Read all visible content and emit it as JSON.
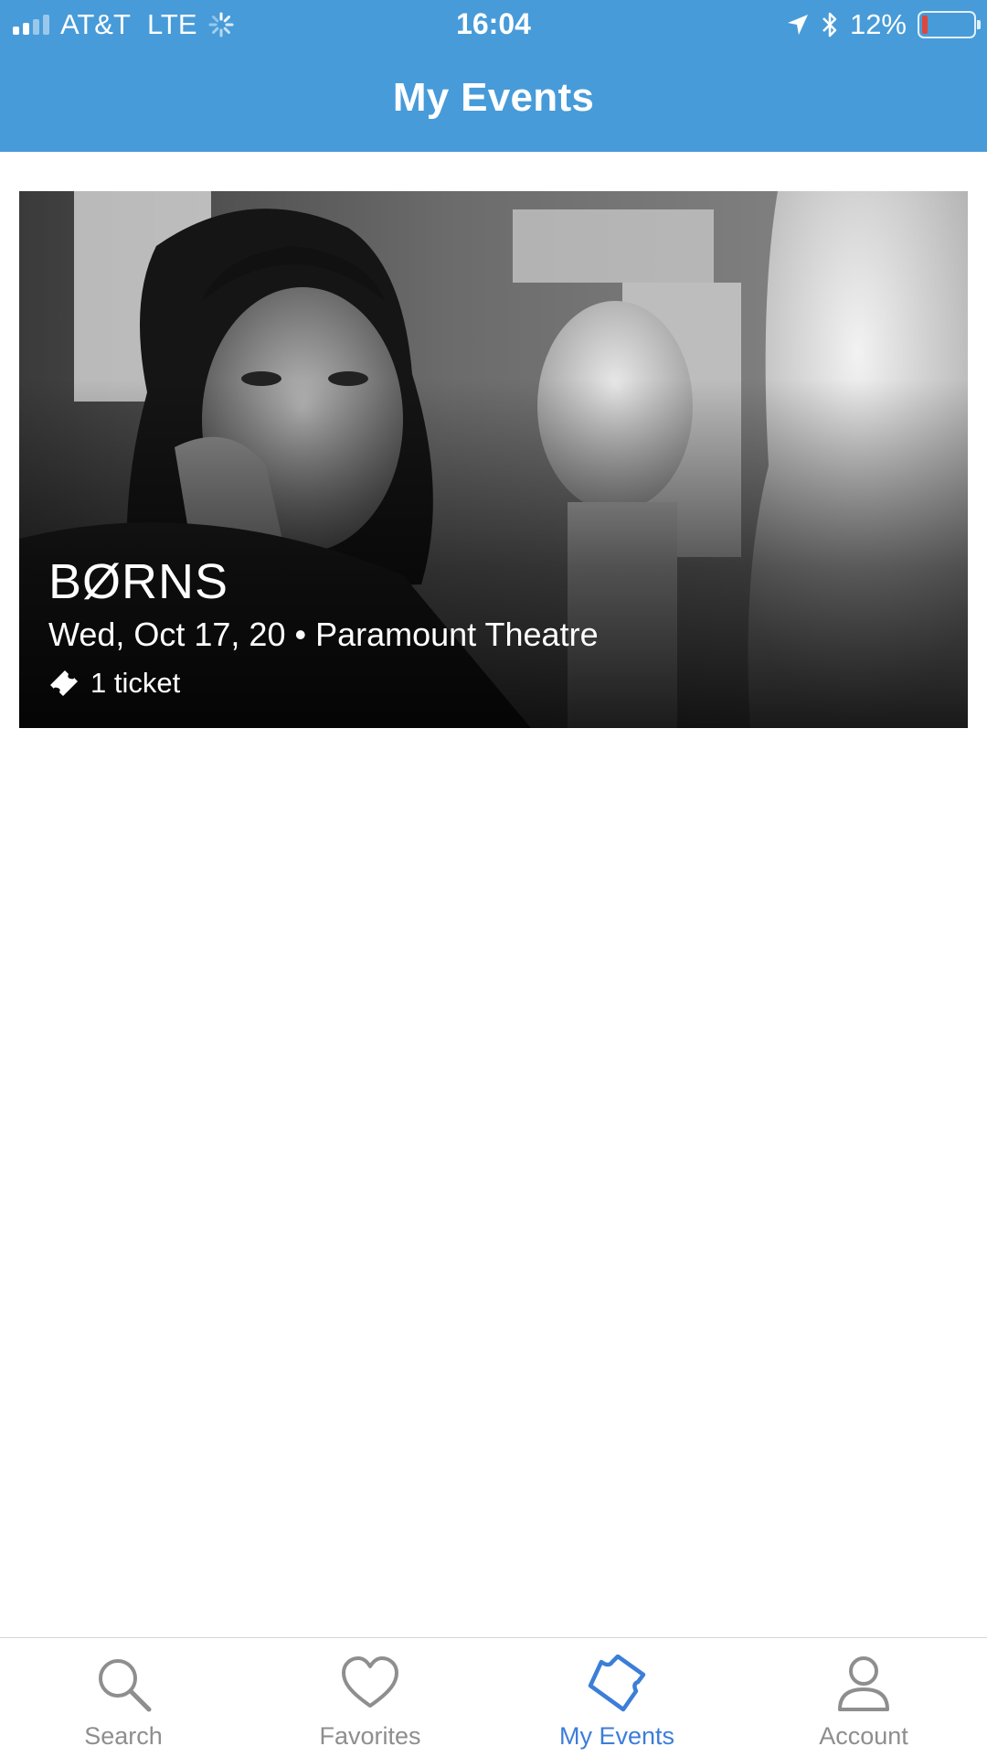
{
  "status_bar": {
    "carrier": "AT&T",
    "network": "LTE",
    "time": "16:04",
    "battery_percent": "12%",
    "battery_level": 0.12
  },
  "header": {
    "title": "My Events"
  },
  "events": [
    {
      "name": "BØRNS",
      "details": "Wed, Oct 17, 20 • Paramount Theatre",
      "tickets": "1 ticket"
    }
  ],
  "tab_bar": {
    "tabs": [
      {
        "label": "Search",
        "icon": "search-icon"
      },
      {
        "label": "Favorites",
        "icon": "heart-icon"
      },
      {
        "label": "My Events",
        "icon": "ticket-icon"
      },
      {
        "label": "Account",
        "icon": "person-icon"
      }
    ],
    "active_index": 2
  },
  "colors": {
    "header": "#479bd9",
    "active_tab": "#3b7ed8",
    "inactive_tab": "#8e8e8e",
    "battery_low": "#e0463a"
  }
}
